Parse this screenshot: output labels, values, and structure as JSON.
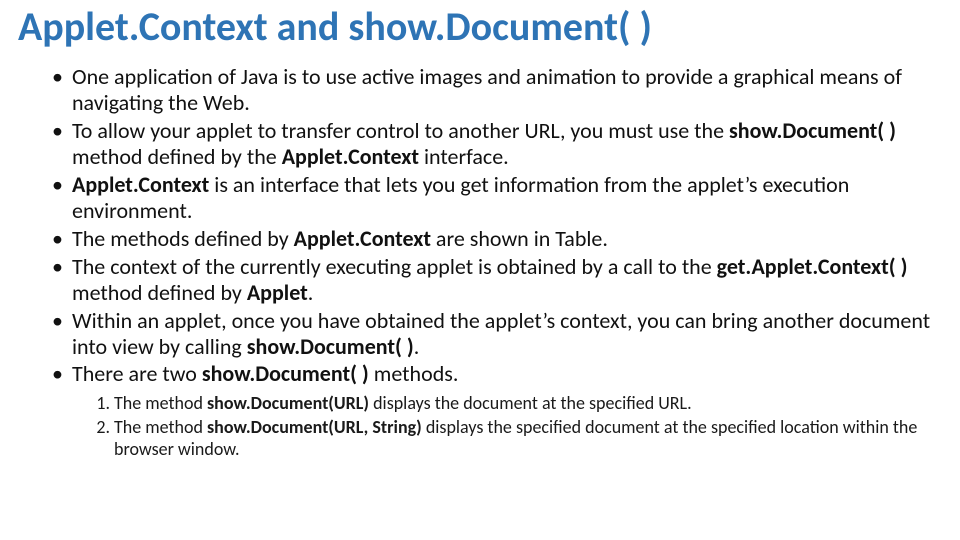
{
  "title": "Applet.Context and show.Document( )",
  "bullets": [
    {
      "pre": "One application of Java is to use active images and animation to provide a graphical means of navigating the Web.",
      "bold": "",
      "post": ""
    },
    {
      "pre": "To allow your applet to transfer control to another URL, you must use the ",
      "bold": "show.Document( )",
      "mid": " method defined by the ",
      "bold2": "Applet.Context",
      "post": " interface."
    },
    {
      "preBold": "Applet.Context",
      "post": " is an interface that lets you get information from the applet’s execution environment."
    },
    {
      "pre": "The methods defined by ",
      "bold": "Applet.Context",
      "post": " are shown in Table."
    },
    {
      "pre": "The context of the currently executing applet is obtained by a call to the ",
      "bold": "get.Applet.Context( )",
      "mid": " method defined by ",
      "bold2": "Applet",
      "post": "."
    },
    {
      "pre": "Within an applet, once you have obtained the applet’s context, you can bring another document into view by calling ",
      "bold": "show.Document( )",
      "post": "."
    },
    {
      "pre": "There are two ",
      "bold": "show.Document( )",
      "post": " methods."
    }
  ],
  "sub": [
    {
      "pre": "The method ",
      "bold": "show.Document(URL)",
      "post": " displays the document at the specified URL."
    },
    {
      "pre": "The method ",
      "bold": "show.Document(URL, String)",
      "post": " displays the specified document at the specified location within the browser window."
    }
  ]
}
